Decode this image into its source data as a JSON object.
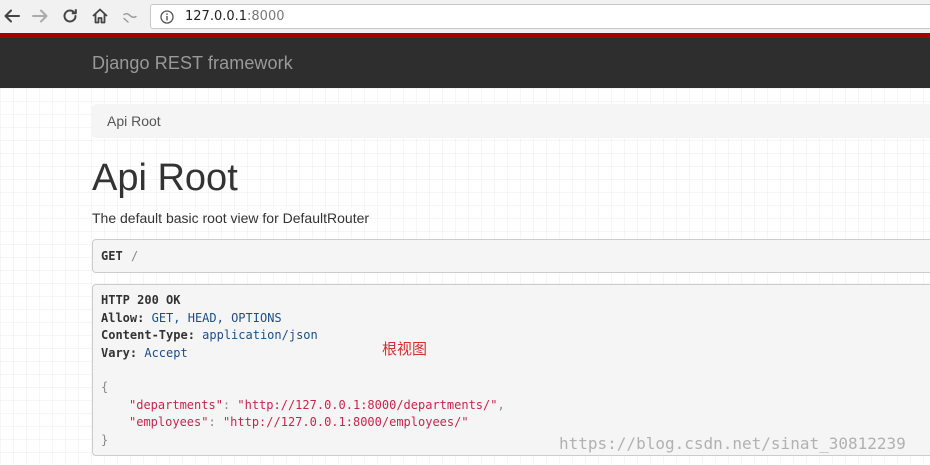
{
  "browser": {
    "url_host": "127.0.0.1",
    "url_port": ":8000",
    "icons": [
      "back-arrow-icon",
      "forward-arrow-icon",
      "reload-icon",
      "home-icon",
      "reader-icon",
      "info-icon"
    ]
  },
  "navbar": {
    "brand": "Django REST framework"
  },
  "breadcrumb": {
    "current": "Api Root"
  },
  "main": {
    "title": "Api Root",
    "description": "The default basic root view for DefaultRouter"
  },
  "request": {
    "method": "GET",
    "path": "/"
  },
  "response": {
    "status_line": "HTTP 200 OK",
    "headers": [
      {
        "name": "Allow:",
        "value": "GET, HEAD, OPTIONS"
      },
      {
        "name": "Content-Type:",
        "value": "application/json"
      },
      {
        "name": "Vary:",
        "value": "Accept"
      }
    ],
    "body_open": "{",
    "body_close": "}",
    "entries": [
      {
        "key": "\"departments\"",
        "value": "\"http://127.0.0.1:8000/departments/\"",
        "trail": ","
      },
      {
        "key": "\"employees\"",
        "value": "\"http://127.0.0.1:8000/employees/\"",
        "trail": ""
      }
    ]
  },
  "annotation": "根视图",
  "watermark": "https://blog.csdn.net/sinat_30812239",
  "colors": {
    "navbar_bg": "#2e2e2e",
    "navbar_accent": "#a30000",
    "json_string": "#c7254e",
    "header_value": "#1d4e89",
    "annotation": "#d03030"
  }
}
